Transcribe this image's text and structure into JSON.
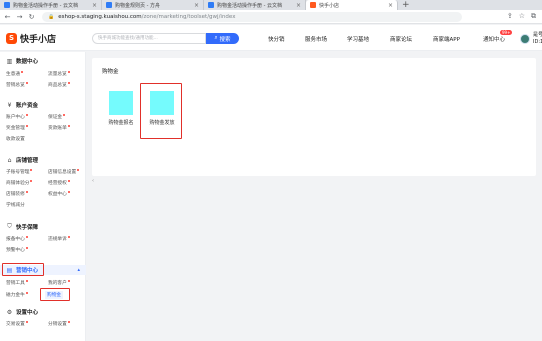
{
  "browser": {
    "tabs": [
      {
        "title": "购物金活动操作手册 - 云文档",
        "favicon": "blue",
        "active": false
      },
      {
        "title": "购物金规则页 - 方舟",
        "favicon": "blue",
        "active": false
      },
      {
        "title": "购物金活动操作手册 - 云文档",
        "favicon": "blue",
        "active": false
      },
      {
        "title": "快手小店",
        "favicon": "orange",
        "active": true
      }
    ],
    "new_tab": "+",
    "url_host": "eshop-s.staging.kuaishou.com",
    "url_path": "/zone/marketing/toolset/gwj/index"
  },
  "header": {
    "logo_text": "快手小店",
    "logo_glyph": "S",
    "search_placeholder": "快手商城功能查找/通用功能...",
    "search_button": "搜索",
    "nav": [
      "快分销",
      "服务市场",
      "学习基地",
      "商家论坛",
      "商家端APP",
      "通知中心"
    ],
    "notify_badge": "99+",
    "account_name": "是号",
    "account_id": "ID:1"
  },
  "sidebar": {
    "sections": [
      {
        "title": "数据中心",
        "icon": "chart-icon",
        "items": [
          [
            "生意通",
            "流量总览"
          ],
          [
            "营销总览",
            "商品总览"
          ]
        ]
      },
      {
        "title": "账户资金",
        "icon": "wallet-icon",
        "items": [
          [
            "账户中心",
            "保证金"
          ],
          [
            "奖金管理",
            "货款账单"
          ],
          [
            "收款设置",
            ""
          ]
        ]
      },
      {
        "title": "店铺管理",
        "icon": "store-icon",
        "items": [
          [
            "子账号管理",
            "店铺信息设置"
          ],
          [
            "商铺体验分",
            "经营授权"
          ],
          [
            "店铺装修",
            "权益中心"
          ],
          [
            "学线减分",
            ""
          ]
        ]
      },
      {
        "title": "快手保障",
        "icon": "shield-icon",
        "items": [
          [
            "报备中心",
            "违规举诉"
          ],
          [
            "预警中心",
            ""
          ]
        ]
      },
      {
        "title": "营销中心",
        "icon": "promo-icon",
        "items": [
          [
            "营销工具",
            "我的客户"
          ],
          [
            "磁力金牛",
            "购物金"
          ]
        ]
      },
      {
        "title": "设置中心",
        "icon": "gear-icon",
        "items": [
          [
            "交易设置",
            "分销设置"
          ]
        ]
      }
    ]
  },
  "main": {
    "title": "购物金",
    "cards": [
      {
        "label": "购物金报名",
        "color": "#75fbfd"
      },
      {
        "label": "购物金发放",
        "color": "#75fbfd"
      }
    ],
    "mark": "‹"
  },
  "colors": {
    "accent": "#326bfb",
    "brand": "#ff4906",
    "highlight": "#e1302a"
  }
}
